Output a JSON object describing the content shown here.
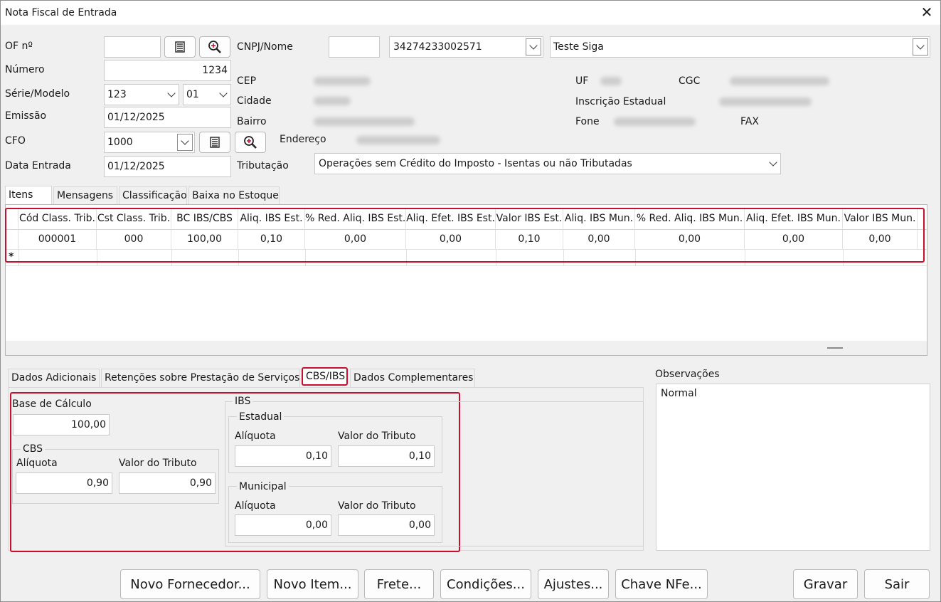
{
  "window": {
    "title": "Nota Fiscal de Entrada"
  },
  "header": {
    "of_label": "OF nº",
    "of_value": "",
    "numero_label": "Número",
    "numero_value": "1234",
    "serie_label": "Série/Modelo",
    "serie_value": "123",
    "modelo_value": "01",
    "emissao_label": "Emissão",
    "emissao_value": "01/12/2025",
    "cfo_label": "CFO",
    "cfo_value": "1000",
    "data_entrada_label": "Data Entrada",
    "data_entrada_value": "01/12/2025",
    "cnpj_label": "CNPJ/Nome",
    "cnpj_code": "",
    "cnpj_value": "34274233002571",
    "nome_value": "Teste Siga",
    "cep_label": "CEP",
    "cidade_label": "Cidade",
    "bairro_label": "Bairro",
    "endereco_label": "Endereço",
    "uf_label": "UF",
    "cgc_label": "CGC",
    "ie_label": "Inscrição Estadual",
    "fone_label": "Fone",
    "fax_label": "FAX",
    "tributacao_label": "Tributação",
    "tributacao_value": "Operações sem Crédito do Imposto - Isentas ou não Tributadas"
  },
  "item_tabs": [
    "Itens",
    "Mensagens",
    "Classificação",
    "Baixa no Estoque"
  ],
  "grid": {
    "columns": [
      "Cód Class. Trib.",
      "Cst Class. Trib.",
      "BC IBS/CBS",
      "Aliq. IBS Est.",
      "% Red. Aliq. IBS Est.",
      "Aliq. Efet. IBS Est.",
      "Valor IBS Est.",
      "Aliq. IBS Mun.",
      "% Red. Aliq. IBS Mun.",
      "Aliq. Efet. IBS Mun.",
      "Valor IBS Mun."
    ],
    "rows": [
      [
        "000001",
        "000",
        "100,00",
        "0,10",
        "0,00",
        "0,00",
        "0,10",
        "0,00",
        "0,00",
        "0,00",
        "0,00"
      ]
    ],
    "new_row_marker": "*"
  },
  "bottom_tabs": [
    "Dados Adicionais",
    "Retenções sobre Prestação de Serviços",
    "CBS/IBS",
    "Dados Complementares"
  ],
  "cbs_ibs": {
    "base_label": "Base de Cálculo",
    "base_value": "100,00",
    "cbs_title": "CBS",
    "aliquota_label": "Alíquota",
    "valor_label": "Valor do Tributo",
    "cbs_aliquota": "0,90",
    "cbs_valor": "0,90",
    "ibs_title": "IBS",
    "estadual_title": "Estadual",
    "est_aliquota": "0,10",
    "est_valor": "0,10",
    "municipal_title": "Municipal",
    "mun_aliquota": "0,00",
    "mun_valor": "0,00"
  },
  "observacoes": {
    "label": "Observações",
    "value": "Normal"
  },
  "buttons": {
    "novo_fornecedor": "Novo Fornecedor...",
    "novo_item": "Novo Item...",
    "frete": "Frete...",
    "condicoes": "Condições...",
    "ajustes": "Ajustes...",
    "chave_nfe": "Chave NFe...",
    "gravar": "Gravar",
    "sair": "Sair"
  },
  "colors": {
    "highlight": "#c8102e",
    "window_bg": "#f0f0f0"
  },
  "icons": [
    "list-icon",
    "magnifier-icon",
    "close-icon",
    "chevron-down-icon"
  ]
}
